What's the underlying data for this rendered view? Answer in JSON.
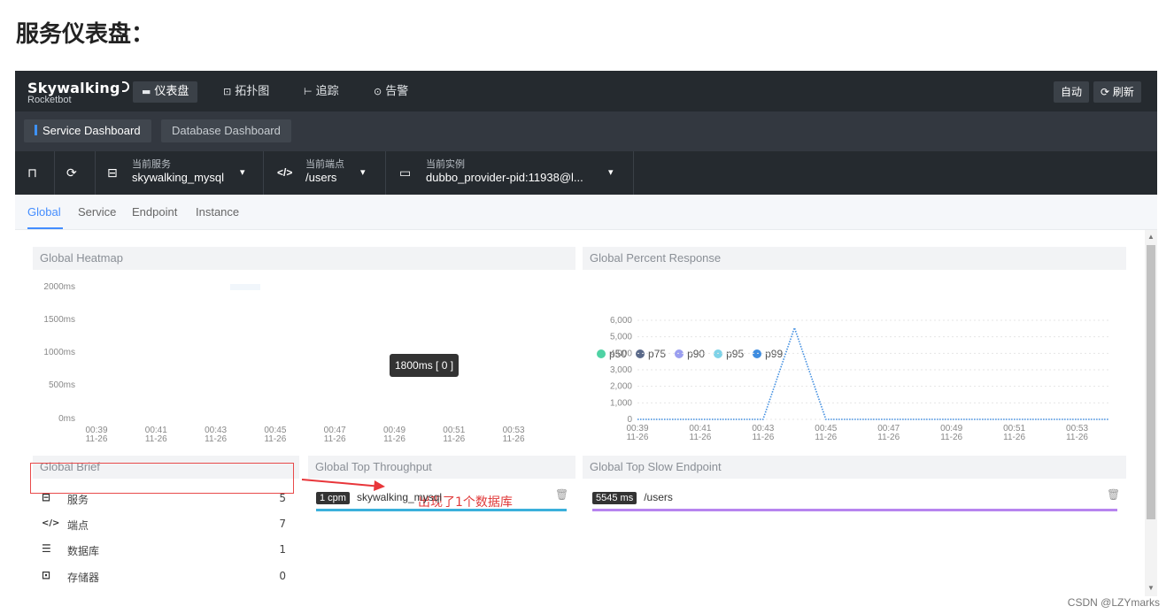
{
  "page_heading": "服务仪表盘：",
  "brand": {
    "name": "Skywalking",
    "sub": "Rocketbot"
  },
  "nav": [
    {
      "icon": "chart-icon",
      "glyph": "▬",
      "label": "仪表盘",
      "active": true
    },
    {
      "icon": "topology-icon",
      "glyph": "⊡",
      "label": "拓扑图",
      "active": false
    },
    {
      "icon": "trace-icon",
      "glyph": "⊢",
      "label": "追踪",
      "active": false
    },
    {
      "icon": "alarm-icon",
      "glyph": "⊙",
      "label": "告警",
      "active": false
    }
  ],
  "top_buttons": {
    "auto": "自动",
    "refresh": "刷新"
  },
  "dash_tabs": [
    {
      "label": "Service Dashboard",
      "active": true
    },
    {
      "label": "Database Dashboard",
      "active": false
    }
  ],
  "selectors": {
    "service": {
      "label": "当前服务",
      "value": "skywalking_mysql"
    },
    "endpoint": {
      "label": "当前端点",
      "value": "/users"
    },
    "instance": {
      "label": "当前实例",
      "value": "dubbo_provider-pid:11938@l..."
    }
  },
  "page_tabs": [
    "Global",
    "Service",
    "Endpoint",
    "Instance"
  ],
  "heatmap": {
    "title": "Global Heatmap",
    "y_labels": [
      "2000ms",
      "1500ms",
      "1000ms",
      "500ms",
      "0ms"
    ],
    "x_times": [
      "00:39",
      "00:41",
      "00:43",
      "00:45",
      "00:47",
      "00:49",
      "00:51",
      "00:53"
    ],
    "x_date": "11-26",
    "tooltip": "1800ms [ 0 ]"
  },
  "chart_data": {
    "type": "line",
    "title": "Global Percent Response",
    "legend": [
      "p50",
      "p75",
      "p90",
      "p95",
      "p99"
    ],
    "legend_colors": [
      "#4fd2a4",
      "#5b6a8a",
      "#9b9ff0",
      "#7fd3e8",
      "#3f8de0"
    ],
    "y_ticks": [
      "6,000",
      "5,000",
      "4,000",
      "3,000",
      "2,000",
      "1,000",
      "0"
    ],
    "ylim": [
      0,
      6000
    ],
    "x_times": [
      "00:39",
      "00:41",
      "00:43",
      "00:45",
      "00:47",
      "00:49",
      "00:51",
      "00:53"
    ],
    "x_date": "11-26",
    "x_minutes": [
      39,
      40,
      41,
      42,
      43,
      44,
      45,
      46,
      47,
      48,
      49,
      50,
      51,
      52,
      53,
      54
    ],
    "series": [
      {
        "name": "p99",
        "color": "#3f8de0",
        "values": [
          0,
          0,
          0,
          0,
          0,
          5545,
          0,
          0,
          0,
          0,
          0,
          0,
          0,
          0,
          0,
          0
        ]
      }
    ],
    "legend_position": "top-left"
  },
  "brief": {
    "title": "Global Brief",
    "items": [
      {
        "icon": "service-icon",
        "glyph": "⊟",
        "label": "服务",
        "value": "5"
      },
      {
        "icon": "endpoint-icon",
        "glyph": "</>",
        "label": "端点",
        "value": "7"
      },
      {
        "icon": "database-icon",
        "glyph": "☰",
        "label": "数据库",
        "value": "1"
      },
      {
        "icon": "storage-icon",
        "glyph": "⊡",
        "label": "存储器",
        "value": "0"
      }
    ]
  },
  "throughput": {
    "title": "Global Top Throughput",
    "items": [
      {
        "badge": "1 cpm",
        "name": "skywalking_mysql",
        "color": "#3bb0db"
      }
    ]
  },
  "slow": {
    "title": "Global Top Slow Endpoint",
    "items": [
      {
        "badge": "5545 ms",
        "name": "/users",
        "color": "#b784ef"
      }
    ]
  },
  "annotation": "出现了1个数据库",
  "watermark": "CSDN @LZYmarks"
}
